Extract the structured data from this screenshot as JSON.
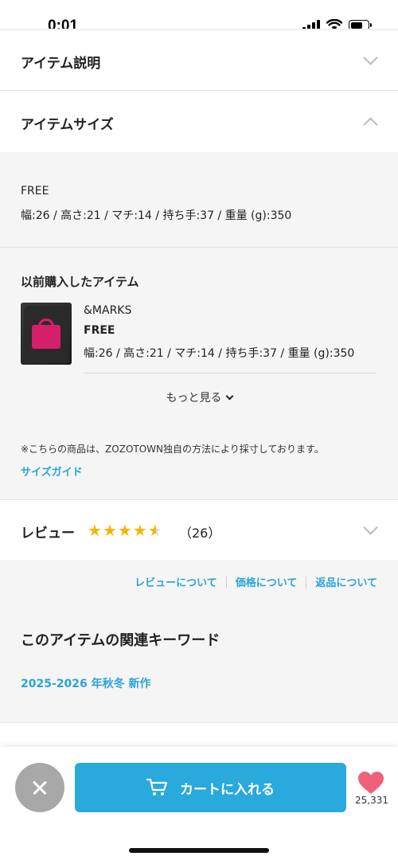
{
  "status_bar": {
    "time": "0:01"
  },
  "accordion": {
    "item_description": {
      "title": "アイテム説明"
    },
    "item_size": {
      "title": "アイテムサイズ"
    }
  },
  "size_info": {
    "size_name": "FREE",
    "measurements": "幅:26 / 高さ:21 / マチ:14 / 持ち手:37 / 重量 (g):350"
  },
  "previous_purchase": {
    "title": "以前購入したアイテム",
    "brand": "&MARKS",
    "size": "FREE",
    "measurements": "幅:26 / 高さ:21 / マチ:14 / 持ち手:37 / 重量 (g):350",
    "more_label": "もっと見る"
  },
  "note": "※こちらの商品は、ZOZOTOWN独自の方法により採寸しております。",
  "size_guide_label": "サイズガイド",
  "review": {
    "label": "レビュー",
    "rating": 4.5,
    "count_text": "（26）"
  },
  "info_links": [
    "レビューについて",
    "価格について",
    "返品について"
  ],
  "keywords": {
    "title": "このアイテムの関連キーワード",
    "items": [
      "2025-2026 年秋冬 新作"
    ]
  },
  "bottom_bar": {
    "cart_label": "カートに入れる",
    "favorite_count": "25,331"
  },
  "colors": {
    "accent": "#29a9dc",
    "link": "#2aa4d6",
    "star": "#f2b705",
    "heart": "#f0607a",
    "close": "#a8a8a8"
  }
}
